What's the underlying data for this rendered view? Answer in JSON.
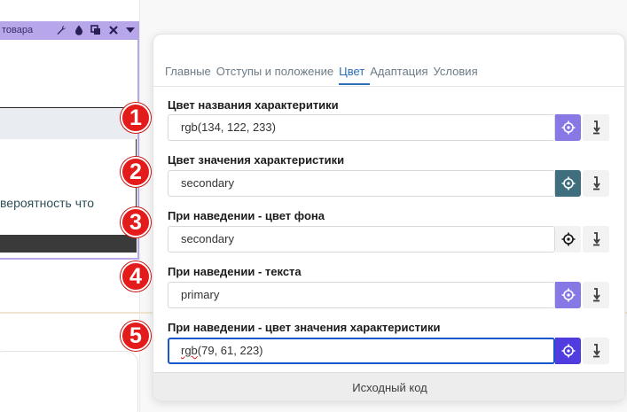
{
  "background": {
    "toolbar_label": "товара",
    "toolbar_icons": [
      "wrench-icon",
      "drop-icon",
      "duplicate-icon",
      "close-icon",
      "caret-down-icon"
    ],
    "partial_text": "вероятность что"
  },
  "markers": [
    "1",
    "2",
    "3",
    "4",
    "5"
  ],
  "panel": {
    "tabs": [
      {
        "label": "Главные",
        "active": false
      },
      {
        "label": "Отступы и положение",
        "active": false
      },
      {
        "label": "Цвет",
        "active": true
      },
      {
        "label": "Адаптация",
        "active": false
      },
      {
        "label": "Условия",
        "active": false
      }
    ],
    "fields": [
      {
        "label": "Цвет названия характеритики",
        "value": "rgb(134, 122, 233)",
        "picker_color": "#8679e6",
        "picker_icon": "crosshair-icon"
      },
      {
        "label": "Цвет значения характеристики",
        "value": "secondary",
        "picker_color": "#3f6f7f",
        "picker_icon": "crosshair-icon"
      },
      {
        "label": "При наведении - цвет фона",
        "value": "secondary",
        "picker_color": "#f2f2f2",
        "picker_icon": "crosshair-icon"
      },
      {
        "label": "При наведении - текста",
        "value": "primary",
        "picker_color": "#8679e6",
        "picker_icon": "crosshair-icon"
      },
      {
        "label": "При наведении - цвет значения характеристики",
        "value_prefix": "rgb",
        "value_rest": "(79, 61, 223)",
        "picker_color": "#4f3ddf",
        "picker_icon": "crosshair-icon"
      }
    ],
    "footer_label": "Исходный код"
  }
}
